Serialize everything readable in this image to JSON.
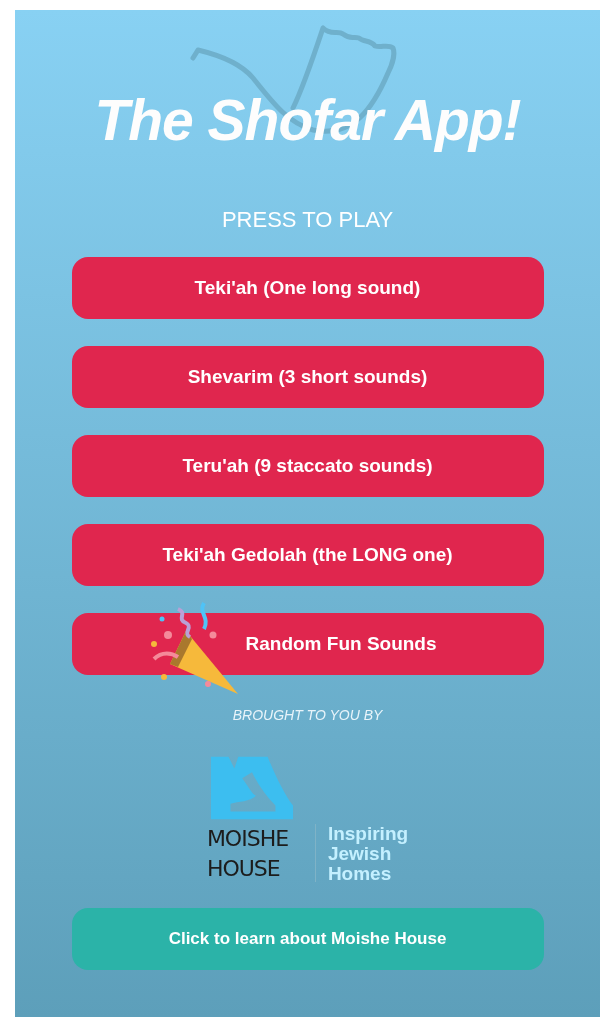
{
  "app_title": "The Shofar App!",
  "section_heading": "PRESS TO PLAY",
  "sound_buttons": [
    {
      "label": "Teki'ah (One long sound)",
      "kind": "plain"
    },
    {
      "label": "Shevarim (3 short sounds)",
      "kind": "plain"
    },
    {
      "label": "Teru'ah (9 staccato sounds)",
      "kind": "plain"
    },
    {
      "label": "Teki'ah Gedolah (the LONG one)",
      "kind": "plain"
    },
    {
      "label": "Random Fun Sounds",
      "kind": "party"
    }
  ],
  "credit": "BROUGHT TO YOU BY",
  "sponsor_logo": {
    "name_lines": [
      "MOISHE",
      "HOUSE"
    ],
    "tagline_lines": [
      "Inspiring",
      "Jewish",
      "Homes"
    ]
  },
  "learn_button": "Click to learn about Moishe House"
}
